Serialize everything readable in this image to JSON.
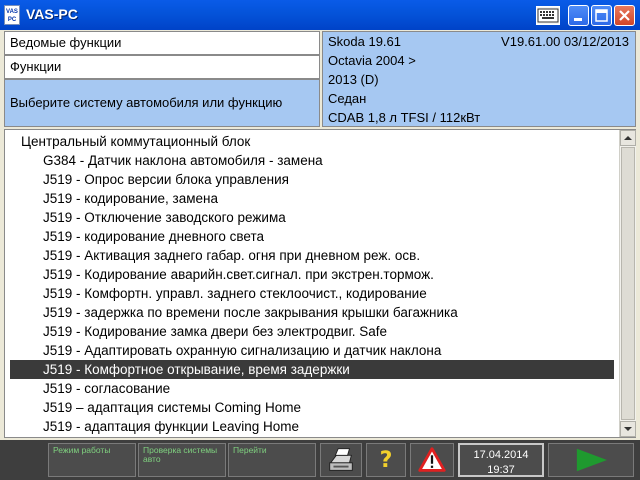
{
  "window": {
    "title": "VAS-PC",
    "logo_text": "VAS PC"
  },
  "header": {
    "row1": "Ведомые функции",
    "row2": "Функции",
    "row3": "Выберите систему автомобиля или функцию"
  },
  "vehicle": {
    "brand_model": "Skoda 19.61",
    "version": "V19.61.00 03/12/2013",
    "model": "Octavia 2004 >",
    "year": "2013 (D)",
    "body": "Седан",
    "engine": "CDAB 1,8 л TFSI / 112кВт"
  },
  "list": {
    "items": [
      "Центральный коммутационный блок",
      "G384 - Датчик наклона автомобиля - замена",
      "J519 - Опрос версии блока управления",
      "J519 - кодирование, замена",
      "J519  - Отключение заводского режима",
      "J519 - кодирование дневного света",
      "J519 - Активация заднего габар. огня при дневном реж. осв.",
      "J519 - Кодирование аварийн.свет.сигнал. при экстрен.тормож.",
      "J519 - Комфортн. управл. заднего стеклоочист., кодирование",
      "J519 - задержка по времени после закрывания крышки багажника",
      "J519 - Кодирование замка двери без электродвиг. Safe",
      "J519 - Адаптировать охранную сигнализацию и датчик наклона",
      "J519 - Комфортное открывание, время задержки",
      "J519 - согласование",
      "J519 – адаптация системы Coming Home",
      "J519 - адаптация функции Leaving Home"
    ],
    "selected_index": 12
  },
  "toolbar": {
    "mode_label": "Режим работы",
    "check_label": "Проверка системы авто",
    "goto_label": "Перейти",
    "help_label": "?",
    "date": "17.04.2014",
    "time": "19:37"
  },
  "colors": {
    "title_bar": "#0453d9",
    "panel_blue": "#a6c8f2",
    "selection": "#3a3a3a",
    "toolbar_bg": "#3e3e3e",
    "toolbar_text": "#7fd17f",
    "help_yellow": "#f2d02c",
    "warning_red": "#e02020",
    "next_green": "#1f9a2f"
  },
  "icons": {
    "app_logo": "vas-pc-logo-icon",
    "keyboard": "keyboard-icon",
    "minimize": "minimize-icon",
    "maximize": "maximize-icon",
    "close": "close-icon",
    "print": "printer-icon",
    "help": "help-icon",
    "warning": "warning-icon",
    "next": "play-forward-icon"
  }
}
